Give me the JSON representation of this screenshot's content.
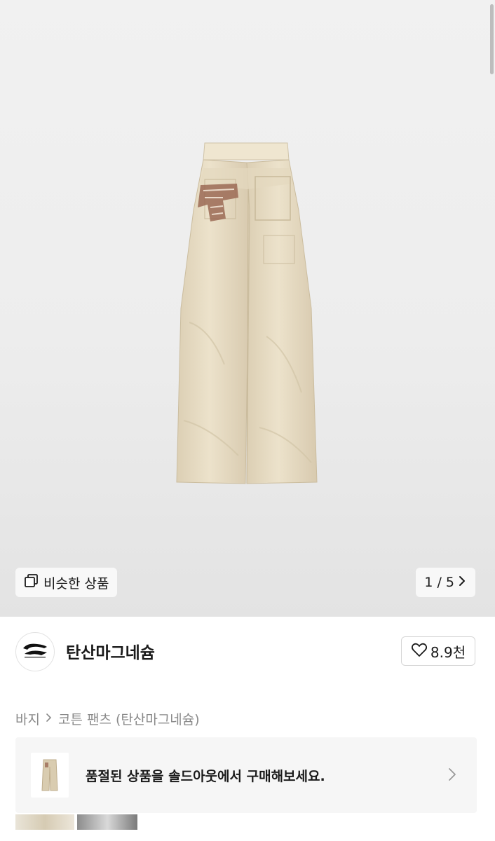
{
  "product_image": {
    "similar_label": "비슷한 상품",
    "counter": "1 / 5"
  },
  "seller": {
    "name": "탄산마그네슘",
    "likes": "8.9천"
  },
  "breadcrumb": {
    "category": "바지",
    "product": "코튼 팬츠 (탄산마그네슘)"
  },
  "soldout_banner": {
    "text": "품절된 상품을 솔드아웃에서 구매해보세요."
  },
  "colors": {
    "pants": "#e8dcc3",
    "patch": "#8a5a44",
    "banner_bg": "#f6f6f6"
  },
  "icons": [
    "copy-icon",
    "chevron-right-icon",
    "heart-icon",
    "brand-logo"
  ]
}
